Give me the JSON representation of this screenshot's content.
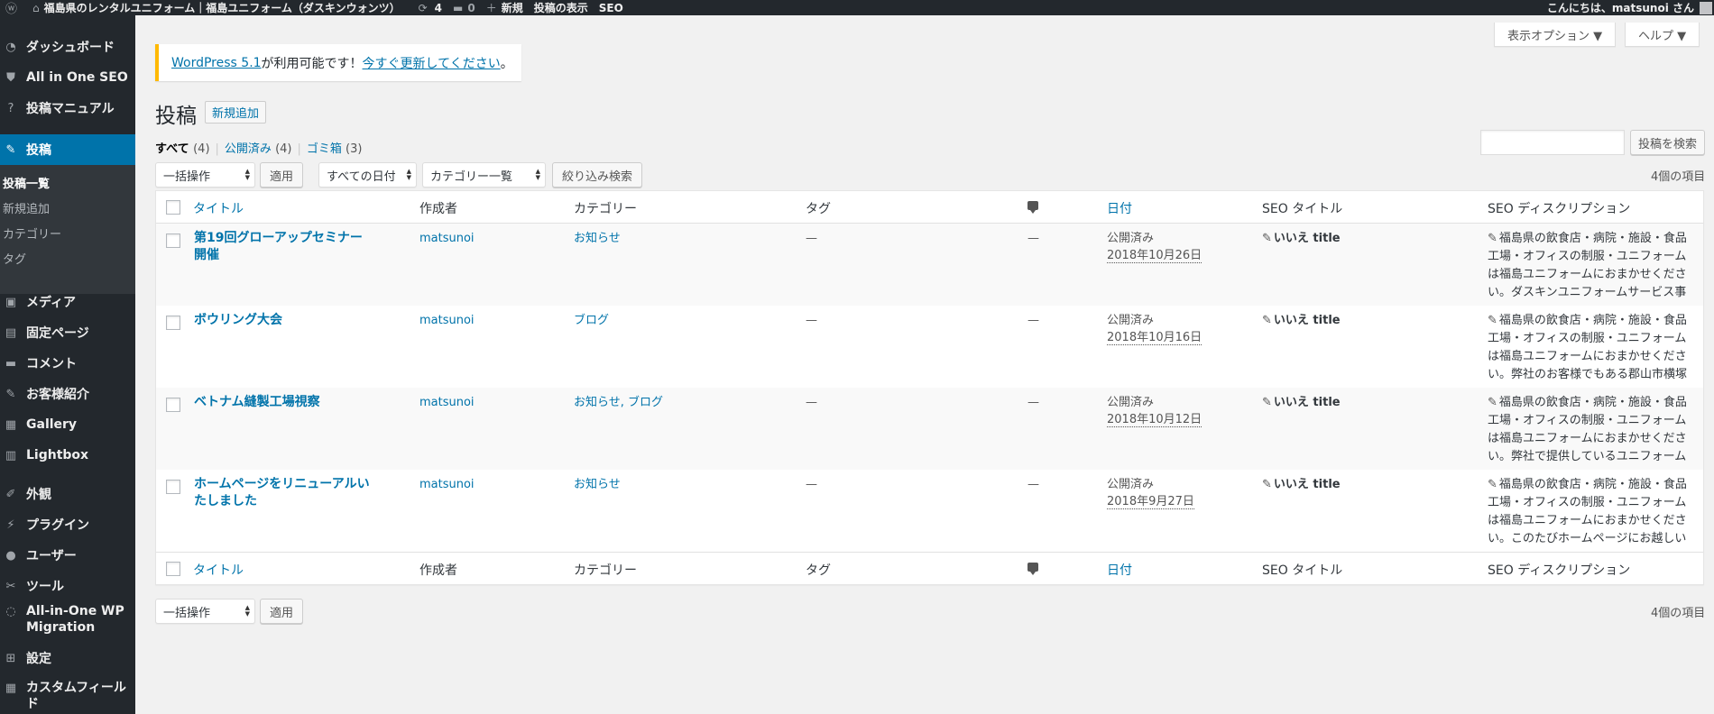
{
  "adminbar": {
    "site_name": "福島県のレンタルユニフォーム｜福島ユニフォーム（ダスキンウォンツ）",
    "updates_count": "4",
    "comments_count": "0",
    "new_label": "新規",
    "view_posts": "投稿の表示",
    "seo": "SEO",
    "greeting": "こんにちは、matsunoi さん"
  },
  "sidebar": {
    "items": [
      {
        "label": "ダッシュボード",
        "icon": "dashboard-icon",
        "glyph": "◔"
      },
      {
        "label": "All in One SEO",
        "icon": "shield-icon",
        "glyph": "⛊"
      },
      {
        "label": "投稿マニュアル",
        "icon": "help-icon",
        "glyph": "?"
      },
      {
        "label": "投稿",
        "icon": "pin-icon",
        "glyph": "✎"
      },
      {
        "label": "メディア",
        "icon": "media-icon",
        "glyph": "▣"
      },
      {
        "label": "固定ページ",
        "icon": "page-icon",
        "glyph": "▤"
      },
      {
        "label": "コメント",
        "icon": "comment-icon",
        "glyph": "▬"
      },
      {
        "label": "お客様紹介",
        "icon": "pin-icon",
        "glyph": "✎"
      },
      {
        "label": "Gallery",
        "icon": "gallery-icon",
        "glyph": "▦"
      },
      {
        "label": "Lightbox",
        "icon": "chart-icon",
        "glyph": "▥"
      },
      {
        "label": "外観",
        "icon": "brush-icon",
        "glyph": "✐"
      },
      {
        "label": "プラグイン",
        "icon": "plugin-icon",
        "glyph": "⚡"
      },
      {
        "label": "ユーザー",
        "icon": "user-icon",
        "glyph": "●"
      },
      {
        "label": "ツール",
        "icon": "wrench-icon",
        "glyph": "✂"
      },
      {
        "label": "All-in-One WP",
        "label2": "Migration",
        "icon": "migration-icon",
        "glyph": "◌"
      },
      {
        "label": "設定",
        "icon": "settings-icon",
        "glyph": "⊞"
      },
      {
        "label": "カスタムフィール",
        "label2": "ド",
        "icon": "fields-icon",
        "glyph": "▦"
      }
    ],
    "submenu": [
      "投稿一覧",
      "新規追加",
      "カテゴリー",
      "タグ"
    ]
  },
  "screen_options": "表示オプション ▼",
  "help": "ヘルプ ▼",
  "notice": {
    "link1": "WordPress 5.1",
    "text": " が利用可能です！",
    "link2": "今すぐ更新してください",
    "end": "。"
  },
  "page_title": "投稿",
  "add_new": "新規追加",
  "filters": {
    "all": "すべて",
    "all_count": "(4)",
    "published": "公開済み",
    "published_count": "(4)",
    "trash": "ゴミ箱",
    "trash_count": "(3)"
  },
  "search_button": "投稿を検索",
  "bulk_action": "一括操作",
  "apply": "適用",
  "date_filter": "すべての日付",
  "category_filter": "カテゴリー一覧",
  "filter_button": "絞り込み検索",
  "items_count": "4個の項目",
  "columns": {
    "title": "タイトル",
    "author": "作成者",
    "categories": "カテゴリー",
    "tags": "タグ",
    "date": "日付",
    "seo_title": "SEO タイトル",
    "seo_desc": "SEO ディスクリプション"
  },
  "rows": [
    {
      "title": "第19回グローアップセミナー開催",
      "author": "matsunoi",
      "categories": "お知らせ",
      "tags": "—",
      "comments": "—",
      "status": "公開済み",
      "date": "2018年10月26日",
      "seo_title": "いいえ title",
      "desc": "福島県の飲食店・病院・施設・食品工場・オフィスの制服・ユニフォームは福島ユニフォームにおまかせください。ダスキンユニフォームサービス事"
    },
    {
      "title": "ボウリング大会",
      "author": "matsunoi",
      "categories": "ブログ",
      "tags": "—",
      "comments": "—",
      "status": "公開済み",
      "date": "2018年10月16日",
      "seo_title": "いいえ title",
      "desc": "福島県の飲食店・病院・施設・食品工場・オフィスの制服・ユニフォームは福島ユニフォームにおまかせください。弊社のお客様でもある郡山市横塚"
    },
    {
      "title": "ベトナム縫製工場視察",
      "author": "matsunoi",
      "categories": "お知らせ, ブログ",
      "tags": "—",
      "comments": "—",
      "status": "公開済み",
      "date": "2018年10月12日",
      "seo_title": "いいえ title",
      "desc": "福島県の飲食店・病院・施設・食品工場・オフィスの制服・ユニフォームは福島ユニフォームにおまかせください。弊社で提供しているユニフォーム"
    },
    {
      "title": "ホームページをリニューアルいたしました",
      "author": "matsunoi",
      "categories": "お知らせ",
      "tags": "—",
      "comments": "—",
      "status": "公開済み",
      "date": "2018年9月27日",
      "seo_title": "いいえ title",
      "desc": "福島県の飲食店・病院・施設・食品工場・オフィスの制服・ユニフォームは福島ユニフォームにおまかせください。このたびホームページにお越しい"
    }
  ],
  "colors": {
    "admin_bg": "#23282d",
    "accent": "#0073aa",
    "notice_warning": "#ffb900"
  }
}
